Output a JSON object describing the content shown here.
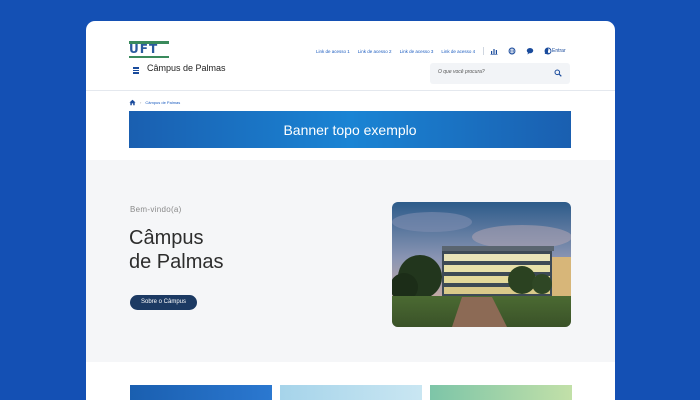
{
  "logo": {
    "text": "UFT"
  },
  "header": {
    "site_title": "Câmpus de Palmas",
    "links": [
      "Link de acesso 1",
      "Link de acesso 2",
      "Link de acesso 3",
      "Link de acesso 4"
    ],
    "icons": [
      "chart-icon",
      "globe-icon",
      "chat-icon",
      "contrast-icon"
    ],
    "login_label": "Entrar",
    "search_placeholder": "O que você procura?"
  },
  "breadcrumb": {
    "current": "Câmpus de Palmas"
  },
  "banner": {
    "text": "Banner topo exemplo"
  },
  "hero": {
    "welcome": "Bem-vindo(a)",
    "title_line1": "Câmpus",
    "title_line2": "de Palmas",
    "button_label": "Sobre o Câmpus"
  },
  "colors": {
    "page_bg": "#1450b4",
    "accent": "#1a4b9c",
    "button_bg": "#1c3a63",
    "hero_bg": "#f5f6f8"
  }
}
